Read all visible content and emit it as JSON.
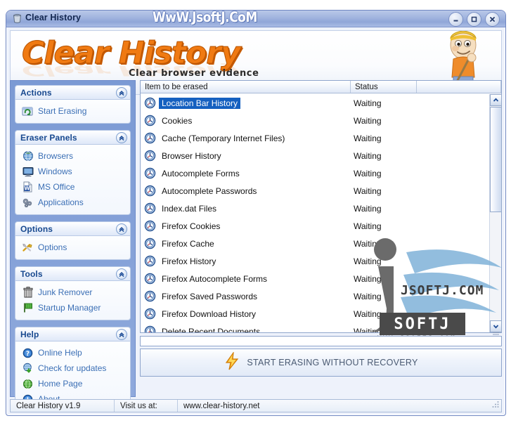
{
  "window": {
    "title": "Clear History",
    "title_icon": "trash-can-icon",
    "watermark": "WwW.JsoftJ.CoM",
    "minimize_label": "–",
    "maximize_label": "□",
    "close_label": "✕"
  },
  "banner": {
    "logo": "Clear History",
    "tagline": "Clear browser evidence",
    "mascot": "janitor-mascot-icon"
  },
  "sidebar": {
    "panels": [
      {
        "title": "Actions",
        "collapse_icon": "chevron-up-icon",
        "items": [
          {
            "label": "Start Erasing",
            "icon": "start-erasing-icon"
          }
        ]
      },
      {
        "title": "Eraser Panels",
        "collapse_icon": "chevron-up-icon",
        "items": [
          {
            "label": "Browsers",
            "icon": "globe-icon"
          },
          {
            "label": "Windows",
            "icon": "monitor-icon"
          },
          {
            "label": "MS Office",
            "icon": "word-document-icon"
          },
          {
            "label": "Applications",
            "icon": "gears-icon"
          }
        ]
      },
      {
        "title": "Options",
        "collapse_icon": "chevron-up-icon",
        "items": [
          {
            "label": "Options",
            "icon": "tools-icon"
          }
        ]
      },
      {
        "title": "Tools",
        "collapse_icon": "chevron-up-icon",
        "items": [
          {
            "label": "Junk Remover",
            "icon": "trash-bin-icon"
          },
          {
            "label": "Startup Manager",
            "icon": "flag-icon"
          }
        ]
      },
      {
        "title": "Help",
        "collapse_icon": "chevron-up-icon",
        "items": [
          {
            "label": "Online Help",
            "icon": "question-mark-icon"
          },
          {
            "label": "Check for updates",
            "icon": "globe-download-icon"
          },
          {
            "label": "Home Page",
            "icon": "green-globe-icon"
          },
          {
            "label": "About",
            "icon": "info-icon"
          }
        ]
      }
    ]
  },
  "list": {
    "columns": [
      "Item to be erased",
      "Status",
      ""
    ],
    "rows": [
      {
        "name": "Location Bar History",
        "status": "Waiting",
        "selected": true
      },
      {
        "name": "Cookies",
        "status": "Waiting",
        "selected": false
      },
      {
        "name": "Cache (Temporary Internet Files)",
        "status": "Waiting",
        "selected": false
      },
      {
        "name": "Browser History",
        "status": "Waiting",
        "selected": false
      },
      {
        "name": "Autocomplete Forms",
        "status": "Waiting",
        "selected": false
      },
      {
        "name": "Autocomplete Passwords",
        "status": "Waiting",
        "selected": false
      },
      {
        "name": "Index.dat Files",
        "status": "Waiting",
        "selected": false
      },
      {
        "name": "Firefox Cookies",
        "status": "Waiting",
        "selected": false
      },
      {
        "name": "Firefox Cache",
        "status": "Waiting",
        "selected": false
      },
      {
        "name": "Firefox History",
        "status": "Waiting",
        "selected": false
      },
      {
        "name": "Firefox Autocomplete Forms",
        "status": "Waiting",
        "selected": false
      },
      {
        "name": "Firefox Saved Passwords",
        "status": "Waiting",
        "selected": false
      },
      {
        "name": "Firefox Download History",
        "status": "Waiting",
        "selected": false
      },
      {
        "name": "Delete Recent Documents",
        "status": "Waiting",
        "selected": false
      }
    ],
    "row_icon": "clock-eraser-icon",
    "scroll_up_icon": "chevron-up-icon",
    "scroll_down_icon": "chevron-down-icon"
  },
  "action": {
    "label": "START ERASING WITHOUT RECOVERY",
    "icon": "lightning-bolt-icon"
  },
  "statusbar": {
    "version": "Clear History v1.9",
    "visit_label": "Visit us at:",
    "url": "www.clear-history.net"
  },
  "overlay_watermark": {
    "dot_com_text": "JSOFTJ.COM",
    "badge_text": "SOFTJ",
    "badge_sub": "WWW.JSOFTJ.COM"
  },
  "colors": {
    "accent_orange": "#f07a12",
    "title_blue": "#90a6d8",
    "sidebar_blue": "#7b9ad4",
    "selection_blue": "#1560c0",
    "link_blue": "#3b6fb5"
  }
}
